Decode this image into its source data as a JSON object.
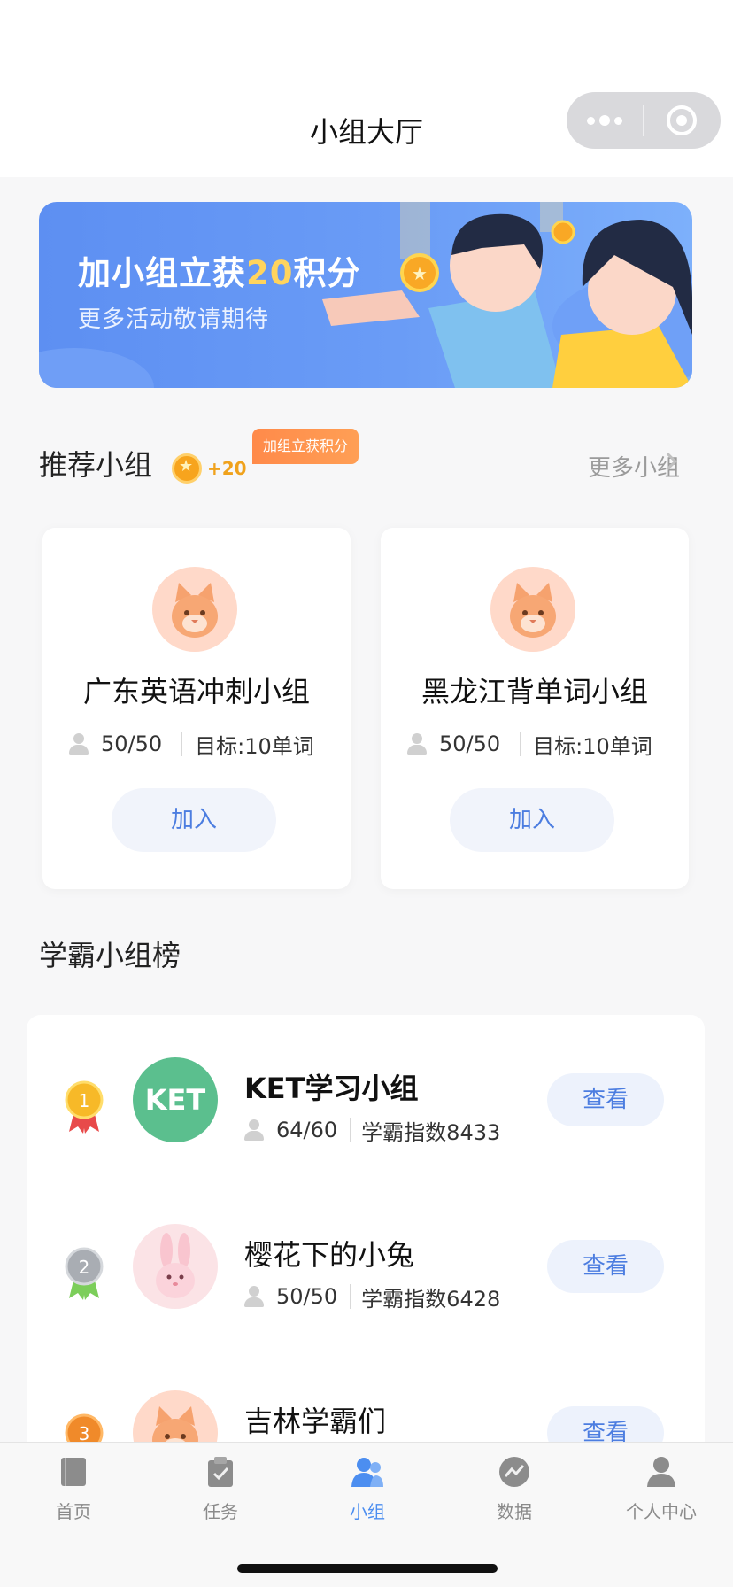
{
  "header": {
    "title": "小组大厅"
  },
  "banner": {
    "title_pre": "加小组立获",
    "title_highlight": "20",
    "title_post": "积分",
    "subtitle": "更多活动敬请期待"
  },
  "recommend": {
    "title": "推荐小组",
    "points": "+20",
    "tag": "加组立获积分",
    "more_label": "更多小组",
    "cards": [
      {
        "name": "广东英语冲刺小组",
        "members": "50/50",
        "goal": "目标:10单词",
        "join_label": "加入",
        "avatar_icon": "cat-avatar"
      },
      {
        "name": "黑龙江背单词小组",
        "members": "50/50",
        "goal": "目标:10单词",
        "join_label": "加入",
        "avatar_icon": "cat-avatar"
      }
    ]
  },
  "ranking": {
    "title": "学霸小组榜",
    "rows": [
      {
        "rank": "1",
        "name": "KET学习小组",
        "avatar_text": "KET",
        "members": "64/60",
        "score": "学霸指数8433",
        "view_label": "查看"
      },
      {
        "rank": "2",
        "name": "樱花下的小兔",
        "avatar_text": "",
        "members": "50/50",
        "score": "学霸指数6428",
        "view_label": "查看"
      },
      {
        "rank": "3",
        "name": "吉林学霸们",
        "avatar_text": "",
        "members": "",
        "score": "",
        "view_label": "查看"
      }
    ]
  },
  "tabbar": {
    "items": [
      {
        "label": "首页",
        "icon": "book-icon"
      },
      {
        "label": "任务",
        "icon": "clipboard-icon"
      },
      {
        "label": "小组",
        "icon": "group-icon"
      },
      {
        "label": "数据",
        "icon": "chart-icon"
      },
      {
        "label": "个人中心",
        "icon": "user-icon"
      }
    ],
    "active": "小组"
  },
  "colors": {
    "accent": "#4c7de0",
    "banner": "#5d8ff2",
    "highlight": "#ffd45e",
    "tag": "#ff8a4a",
    "ket_avatar": "#5bbf8e"
  }
}
